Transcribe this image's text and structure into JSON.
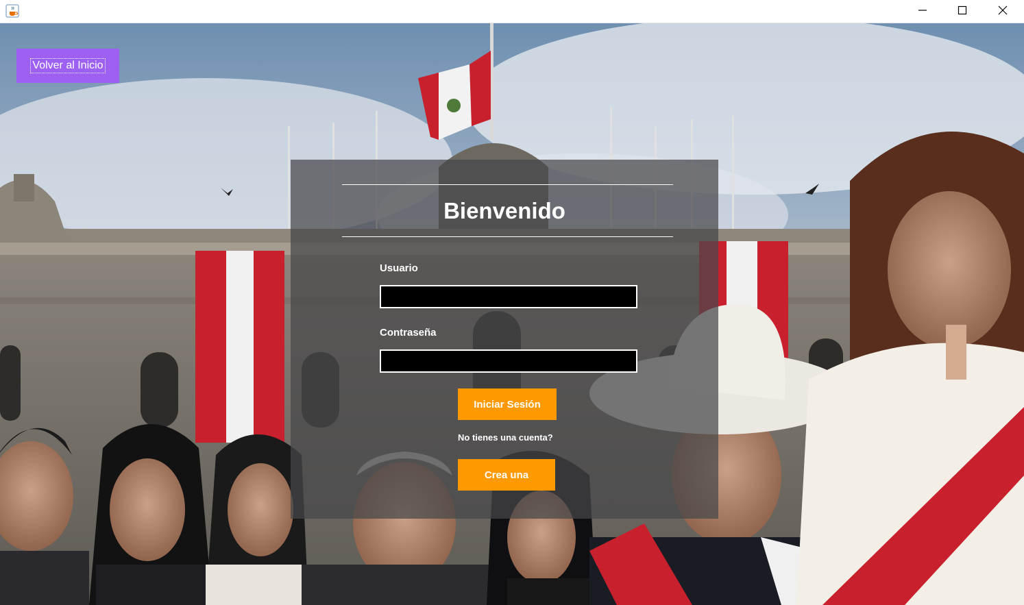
{
  "window": {
    "minimize_icon": "minimize-icon",
    "maximize_icon": "maximize-icon",
    "close_icon": "close-icon",
    "app_icon": "java-cup-icon"
  },
  "nav": {
    "back_label": "Volver al Inicio"
  },
  "login": {
    "title": "Bienvenido",
    "username_label": "Usuario",
    "username_value": "",
    "password_label": "Contraseña",
    "password_value": "",
    "submit_label": "Iniciar Sesión",
    "no_account_text": "No tienes una cuenta?",
    "create_label": "Crea una"
  },
  "colors": {
    "back_button": "#9d60f2",
    "action_buttons": "#ff9900",
    "panel": "rgba(70,70,74,0.72)",
    "field_bg": "#000000"
  },
  "background": {
    "description_icon": "photo-background"
  }
}
